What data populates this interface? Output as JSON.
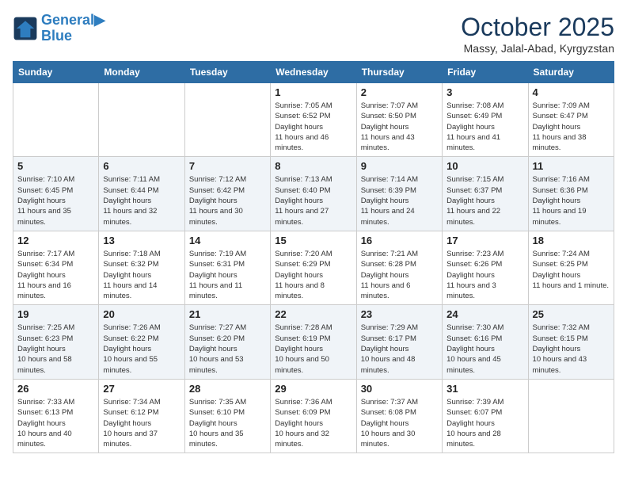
{
  "header": {
    "logo_line1": "General",
    "logo_line2": "Blue",
    "month": "October 2025",
    "location": "Massy, Jalal-Abad, Kyrgyzstan"
  },
  "days_of_week": [
    "Sunday",
    "Monday",
    "Tuesday",
    "Wednesday",
    "Thursday",
    "Friday",
    "Saturday"
  ],
  "weeks": [
    [
      {
        "num": "",
        "sunrise": "",
        "sunset": "",
        "daylight": ""
      },
      {
        "num": "",
        "sunrise": "",
        "sunset": "",
        "daylight": ""
      },
      {
        "num": "",
        "sunrise": "",
        "sunset": "",
        "daylight": ""
      },
      {
        "num": "1",
        "sunrise": "7:05 AM",
        "sunset": "6:52 PM",
        "daylight": "11 hours and 46 minutes."
      },
      {
        "num": "2",
        "sunrise": "7:07 AM",
        "sunset": "6:50 PM",
        "daylight": "11 hours and 43 minutes."
      },
      {
        "num": "3",
        "sunrise": "7:08 AM",
        "sunset": "6:49 PM",
        "daylight": "11 hours and 41 minutes."
      },
      {
        "num": "4",
        "sunrise": "7:09 AM",
        "sunset": "6:47 PM",
        "daylight": "11 hours and 38 minutes."
      }
    ],
    [
      {
        "num": "5",
        "sunrise": "7:10 AM",
        "sunset": "6:45 PM",
        "daylight": "11 hours and 35 minutes."
      },
      {
        "num": "6",
        "sunrise": "7:11 AM",
        "sunset": "6:44 PM",
        "daylight": "11 hours and 32 minutes."
      },
      {
        "num": "7",
        "sunrise": "7:12 AM",
        "sunset": "6:42 PM",
        "daylight": "11 hours and 30 minutes."
      },
      {
        "num": "8",
        "sunrise": "7:13 AM",
        "sunset": "6:40 PM",
        "daylight": "11 hours and 27 minutes."
      },
      {
        "num": "9",
        "sunrise": "7:14 AM",
        "sunset": "6:39 PM",
        "daylight": "11 hours and 24 minutes."
      },
      {
        "num": "10",
        "sunrise": "7:15 AM",
        "sunset": "6:37 PM",
        "daylight": "11 hours and 22 minutes."
      },
      {
        "num": "11",
        "sunrise": "7:16 AM",
        "sunset": "6:36 PM",
        "daylight": "11 hours and 19 minutes."
      }
    ],
    [
      {
        "num": "12",
        "sunrise": "7:17 AM",
        "sunset": "6:34 PM",
        "daylight": "11 hours and 16 minutes."
      },
      {
        "num": "13",
        "sunrise": "7:18 AM",
        "sunset": "6:32 PM",
        "daylight": "11 hours and 14 minutes."
      },
      {
        "num": "14",
        "sunrise": "7:19 AM",
        "sunset": "6:31 PM",
        "daylight": "11 hours and 11 minutes."
      },
      {
        "num": "15",
        "sunrise": "7:20 AM",
        "sunset": "6:29 PM",
        "daylight": "11 hours and 8 minutes."
      },
      {
        "num": "16",
        "sunrise": "7:21 AM",
        "sunset": "6:28 PM",
        "daylight": "11 hours and 6 minutes."
      },
      {
        "num": "17",
        "sunrise": "7:23 AM",
        "sunset": "6:26 PM",
        "daylight": "11 hours and 3 minutes."
      },
      {
        "num": "18",
        "sunrise": "7:24 AM",
        "sunset": "6:25 PM",
        "daylight": "11 hours and 1 minute."
      }
    ],
    [
      {
        "num": "19",
        "sunrise": "7:25 AM",
        "sunset": "6:23 PM",
        "daylight": "10 hours and 58 minutes."
      },
      {
        "num": "20",
        "sunrise": "7:26 AM",
        "sunset": "6:22 PM",
        "daylight": "10 hours and 55 minutes."
      },
      {
        "num": "21",
        "sunrise": "7:27 AM",
        "sunset": "6:20 PM",
        "daylight": "10 hours and 53 minutes."
      },
      {
        "num": "22",
        "sunrise": "7:28 AM",
        "sunset": "6:19 PM",
        "daylight": "10 hours and 50 minutes."
      },
      {
        "num": "23",
        "sunrise": "7:29 AM",
        "sunset": "6:17 PM",
        "daylight": "10 hours and 48 minutes."
      },
      {
        "num": "24",
        "sunrise": "7:30 AM",
        "sunset": "6:16 PM",
        "daylight": "10 hours and 45 minutes."
      },
      {
        "num": "25",
        "sunrise": "7:32 AM",
        "sunset": "6:15 PM",
        "daylight": "10 hours and 43 minutes."
      }
    ],
    [
      {
        "num": "26",
        "sunrise": "7:33 AM",
        "sunset": "6:13 PM",
        "daylight": "10 hours and 40 minutes."
      },
      {
        "num": "27",
        "sunrise": "7:34 AM",
        "sunset": "6:12 PM",
        "daylight": "10 hours and 37 minutes."
      },
      {
        "num": "28",
        "sunrise": "7:35 AM",
        "sunset": "6:10 PM",
        "daylight": "10 hours and 35 minutes."
      },
      {
        "num": "29",
        "sunrise": "7:36 AM",
        "sunset": "6:09 PM",
        "daylight": "10 hours and 32 minutes."
      },
      {
        "num": "30",
        "sunrise": "7:37 AM",
        "sunset": "6:08 PM",
        "daylight": "10 hours and 30 minutes."
      },
      {
        "num": "31",
        "sunrise": "7:39 AM",
        "sunset": "6:07 PM",
        "daylight": "10 hours and 28 minutes."
      },
      {
        "num": "",
        "sunrise": "",
        "sunset": "",
        "daylight": ""
      }
    ]
  ]
}
